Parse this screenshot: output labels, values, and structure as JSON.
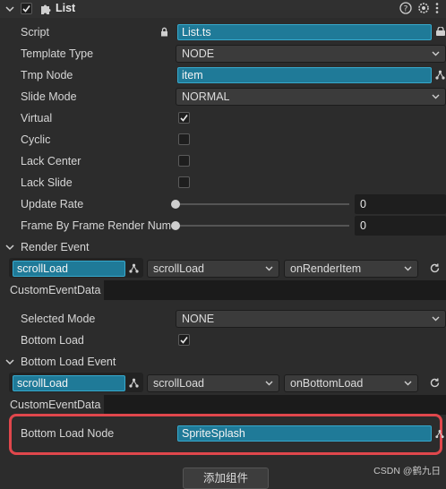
{
  "header": {
    "title": "List"
  },
  "props": {
    "script": {
      "label": "Script",
      "value": "List.ts"
    },
    "template_type": {
      "label": "Template Type",
      "value": "NODE"
    },
    "tmp_node": {
      "label": "Tmp Node",
      "value": "item"
    },
    "slide_mode": {
      "label": "Slide Mode",
      "value": "NORMAL"
    },
    "virtual": {
      "label": "Virtual",
      "checked": true
    },
    "cyclic": {
      "label": "Cyclic",
      "checked": false
    },
    "lack_center": {
      "label": "Lack Center",
      "checked": false
    },
    "lack_slide": {
      "label": "Lack Slide",
      "checked": false
    },
    "update_rate": {
      "label": "Update Rate",
      "value": "0",
      "slider_fraction": 0
    },
    "frame_by_frame": {
      "label": "Frame By Frame Render Num",
      "value": "0",
      "slider_fraction": 0
    },
    "render_event": {
      "label": "Render Event",
      "target": "scrollLoad",
      "component": "scrollLoad",
      "handler": "onRenderItem"
    },
    "custom_event_data_1": {
      "label": "CustomEventData",
      "value": ""
    },
    "selected_mode": {
      "label": "Selected Mode",
      "value": "NONE"
    },
    "bottom_load": {
      "label": "Bottom Load",
      "checked": true
    },
    "bottom_load_event": {
      "label": "Bottom Load Event",
      "target": "scrollLoad",
      "component": "scrollLoad",
      "handler": "onBottomLoad"
    },
    "custom_event_data_2": {
      "label": "CustomEventData",
      "value": ""
    },
    "bottom_load_node": {
      "label": "Bottom Load Node",
      "value": "SpriteSplash"
    }
  },
  "footer": {
    "add_component": "添加组件"
  },
  "watermark": "CSDN @鹤九日",
  "colors": {
    "accent_field": "#1f7a98",
    "highlight": "#e0474c"
  }
}
